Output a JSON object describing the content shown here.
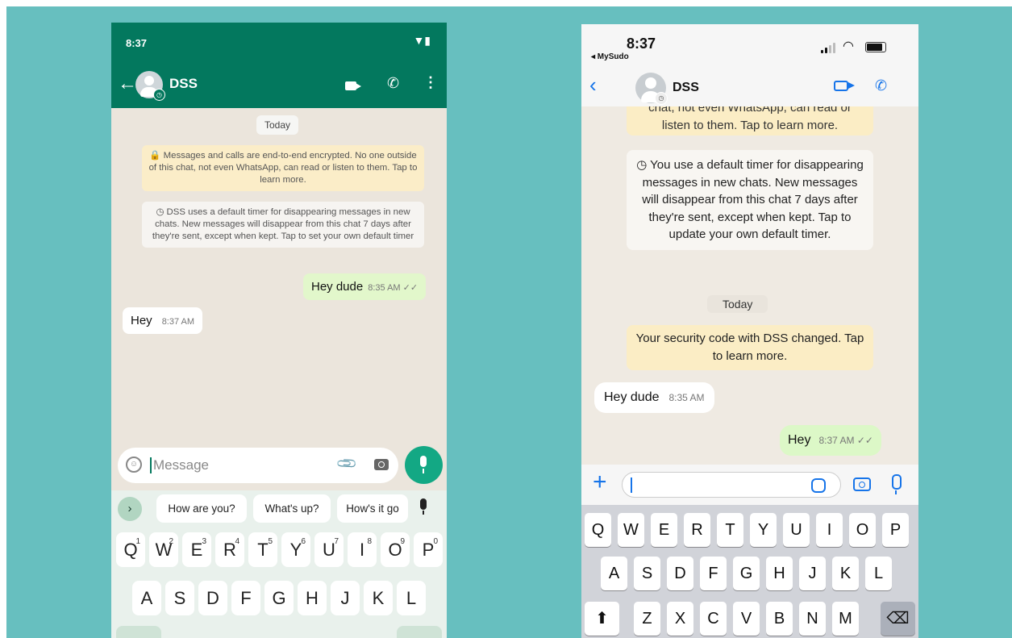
{
  "android": {
    "status_time": "8:37",
    "contact_name": "DSS",
    "date_chip": "Today",
    "encryption_notice": "🔒 Messages and calls are end-to-end encrypted. No one outside of this chat, not even WhatsApp, can read or listen to them. Tap to learn more.",
    "timer_notice": "◷ DSS uses a default timer for disappearing messages in new chats. New messages will disappear from this chat 7 days after they're sent, except when kept. Tap to set your own default timer",
    "outgoing": {
      "text": "Hey dude",
      "time": "8:35 AM ✓✓"
    },
    "incoming": {
      "text": "Hey",
      "time": "8:37 AM"
    },
    "input_placeholder": "Message",
    "suggestions": [
      "How are you?",
      "What's up?",
      "How's it go"
    ],
    "keyboard": {
      "row1": [
        {
          "k": "Q",
          "n": "1"
        },
        {
          "k": "W",
          "n": "2"
        },
        {
          "k": "E",
          "n": "3"
        },
        {
          "k": "R",
          "n": "4"
        },
        {
          "k": "T",
          "n": "5"
        },
        {
          "k": "Y",
          "n": "6"
        },
        {
          "k": "U",
          "n": "7"
        },
        {
          "k": "I",
          "n": "8"
        },
        {
          "k": "O",
          "n": "9"
        },
        {
          "k": "P",
          "n": "0"
        }
      ],
      "row2": [
        "A",
        "S",
        "D",
        "F",
        "G",
        "H",
        "J",
        "K",
        "L"
      ]
    },
    "icons": {
      "back": "arrow-left-icon",
      "video": "video-call-icon",
      "call": "phone-icon",
      "menu": "more-vert-icon",
      "emoji": "emoji-icon",
      "attach": "paperclip-icon",
      "camera": "camera-icon",
      "mic": "mic-icon"
    }
  },
  "ios": {
    "status_time": "8:37",
    "back_app": "◂ MySudo",
    "contact_name": "DSS",
    "encryption_tail": "chat, not even WhatsApp, can read or listen to them. Tap to learn more.",
    "encryption_tail_line1": "chat, not even WhatsApp, can read or",
    "encryption_tail_line2": "listen to them. Tap to learn more.",
    "timer_notice": "◷ You use a default timer for disappearing messages in new chats. New messages will disappear from this chat 7 days after they're sent, except when kept. Tap to update your own default timer.",
    "date_chip": "Today",
    "security_notice": "Your security code with DSS changed. Tap to learn more.",
    "incoming": {
      "text": "Hey dude",
      "time": "8:35 AM"
    },
    "outgoing": {
      "text": "Hey",
      "time": "8:37 AM ✓✓"
    },
    "keyboard": {
      "row1": [
        "Q",
        "W",
        "E",
        "R",
        "T",
        "Y",
        "U",
        "I",
        "O",
        "P"
      ],
      "row2": [
        "A",
        "S",
        "D",
        "F",
        "G",
        "H",
        "J",
        "K",
        "L"
      ],
      "row3": [
        "Z",
        "X",
        "C",
        "V",
        "B",
        "N",
        "M"
      ]
    },
    "icons": {
      "back": "chevron-left-icon",
      "video": "video-call-icon",
      "call": "phone-icon",
      "plus": "plus-icon",
      "sticker": "sticker-icon",
      "camera": "camera-icon",
      "mic": "mic-icon",
      "shift": "shift-icon",
      "delete": "backspace-icon"
    }
  },
  "colors": {
    "background": "#67bfbf",
    "android_header": "#03785e",
    "android_fab": "#13a884",
    "ios_accent": "#1674e9",
    "outgoing_bubble": "#dcf8c7",
    "system_notice": "#fbedc5"
  }
}
